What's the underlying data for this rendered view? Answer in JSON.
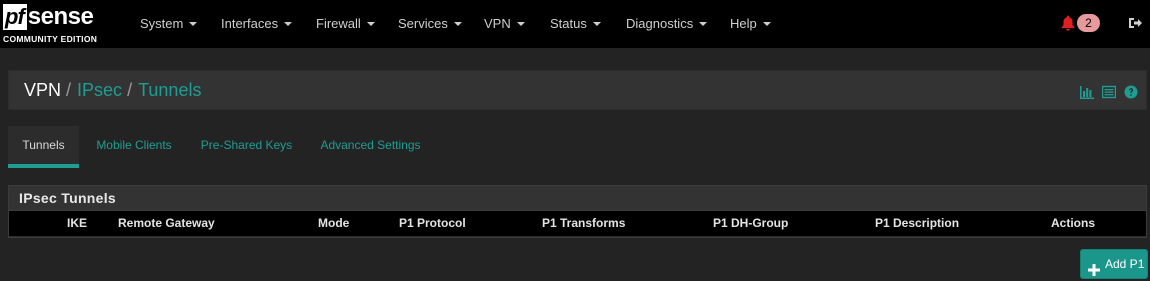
{
  "logo": {
    "pf": "pf",
    "sense": "sense",
    "subtitle": "COMMUNITY EDITION"
  },
  "nav": [
    {
      "label": "System"
    },
    {
      "label": "Interfaces"
    },
    {
      "label": "Firewall"
    },
    {
      "label": "Services"
    },
    {
      "label": "VPN"
    },
    {
      "label": "Status"
    },
    {
      "label": "Diagnostics"
    },
    {
      "label": "Help"
    }
  ],
  "notifications": {
    "count": "2",
    "icon": "bell-icon"
  },
  "breadcrumb": {
    "root": "VPN",
    "separator": "/",
    "level2": "IPsec",
    "level3": "Tunnels"
  },
  "panel_icons": [
    "bar-chart-icon",
    "list-icon",
    "help-circle-icon"
  ],
  "tabs": [
    {
      "label": "Tunnels",
      "active": true
    },
    {
      "label": "Mobile Clients",
      "active": false
    },
    {
      "label": "Pre-Shared Keys",
      "active": false
    },
    {
      "label": "Advanced Settings",
      "active": false
    }
  ],
  "table": {
    "title": "IPsec Tunnels",
    "columns": [
      "IKE",
      "Remote Gateway",
      "Mode",
      "P1 Protocol",
      "P1 Transforms",
      "P1 DH-Group",
      "P1 Description",
      "Actions"
    ],
    "rows": []
  },
  "add_button": {
    "label": "Add P1"
  },
  "colors": {
    "accent": "#1f9d93",
    "navbar": "#000000",
    "background": "#232323",
    "badge": "#e79a9c",
    "bell": "#e02020"
  }
}
